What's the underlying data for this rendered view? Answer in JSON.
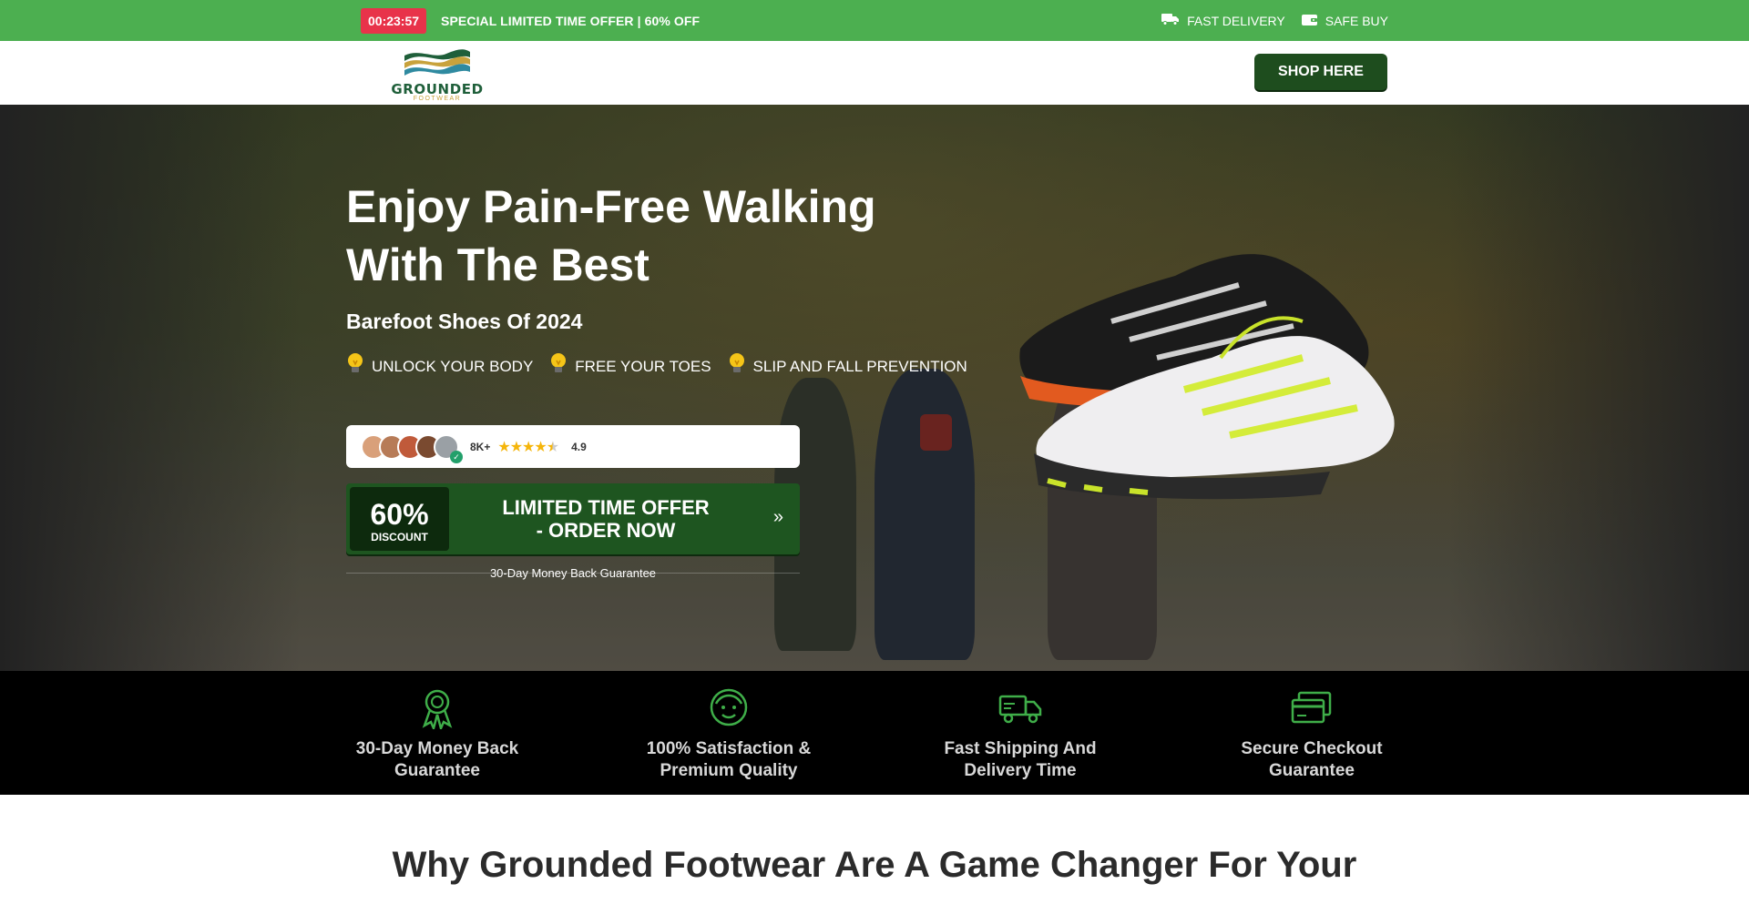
{
  "topbar": {
    "timer": "00:23:57",
    "offer": "SPECIAL LIMITED TIME OFFER | 60% OFF",
    "badges": [
      {
        "icon": "truck-icon",
        "label": "FAST DELIVERY"
      },
      {
        "icon": "wallet-icon",
        "label": "SAFE BUY"
      }
    ],
    "background": "#4caf50",
    "timer_color": "#e8334a"
  },
  "header": {
    "logo_text": "GROUNDED",
    "logo_sub": "FOOTWEAR",
    "shop_label": "SHOP HERE"
  },
  "hero": {
    "headline": "Enjoy Pain-Free Walking With The Best",
    "subhead": "Barefoot Shoes Of 2024",
    "benefits": [
      {
        "icon": "lightbulb-icon",
        "label": "UNLOCK YOUR BODY"
      },
      {
        "icon": "lightbulb-icon",
        "label": "FREE YOUR TOES"
      },
      {
        "icon": "lightbulb-icon",
        "label": "SLIP AND FALL PREVENTION"
      }
    ],
    "rating": {
      "count": "8K+",
      "score": "4.9",
      "stars": 4.5
    },
    "cta": {
      "discount_pct": "60%",
      "discount_label": "DISCOUNT",
      "text": "LIMITED TIME OFFER - ORDER NOW",
      "arrow": "»"
    },
    "guarantee": "30-Day Money Back Guarantee"
  },
  "trust": [
    {
      "icon": "award-ribbon-icon",
      "label": "30-Day Money Back Guarantee"
    },
    {
      "icon": "happy-face-icon",
      "label": "100% Satisfaction & Premium Quality"
    },
    {
      "icon": "delivery-truck-icon",
      "label": "Fast Shipping And Delivery Time"
    },
    {
      "icon": "credit-card-icon",
      "label": "Secure Checkout Guarantee"
    }
  ],
  "section": {
    "title": "Why Grounded Footwear Are A Game Changer For Your"
  },
  "colors": {
    "brand_green": "#4caf50",
    "dark_green": "#1e4d1e",
    "icon_green": "#3fae49"
  }
}
